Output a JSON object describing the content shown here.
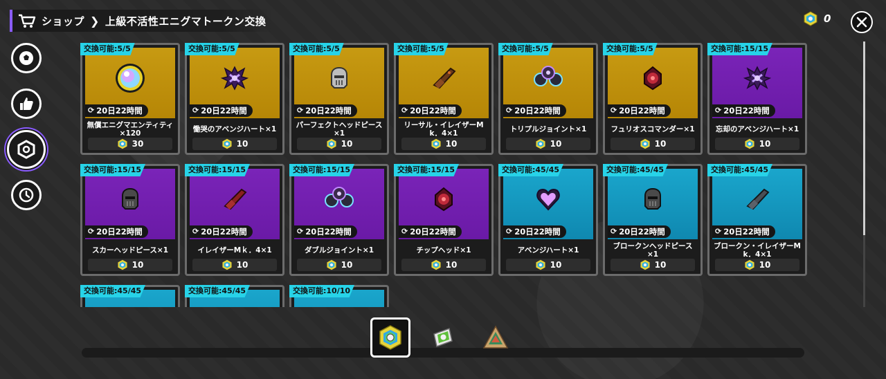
{
  "header": {
    "section": "ショップ",
    "separator": "❯",
    "title": "上級不活性エニグマトークン交換"
  },
  "currency": {
    "value": "0"
  },
  "sidebar": [
    {
      "name": "sidebar-ball",
      "icon": "ball-icon"
    },
    {
      "name": "sidebar-like",
      "icon": "thumbs-up-icon"
    },
    {
      "name": "sidebar-token",
      "icon": "token-icon",
      "active": true
    },
    {
      "name": "sidebar-clock",
      "icon": "clock-icon"
    }
  ],
  "cards": [
    {
      "limit": "交換可能:5/5",
      "timer": "20日22時間",
      "name": "無償エニグマエンティティ\n×120",
      "price": "30",
      "color": "gold",
      "art": "orb"
    },
    {
      "limit": "交換可能:5/5",
      "timer": "20日22時間",
      "name": "慟哭のアベンジハート×1",
      "price": "10",
      "color": "gold",
      "art": "heart-dark"
    },
    {
      "limit": "交換可能:5/5",
      "timer": "20日22時間",
      "name": "パーフェクトヘッドピース\n×1",
      "price": "10",
      "color": "gold",
      "art": "helmet-silver"
    },
    {
      "limit": "交換可能:5/5",
      "timer": "20日22時間",
      "name": "リーサル・イレイザーM\nk．4×1",
      "price": "10",
      "color": "gold",
      "art": "arm-brown"
    },
    {
      "limit": "交換可能:5/5",
      "timer": "20日22時間",
      "name": "トリプルジョイント×1",
      "price": "10",
      "color": "gold",
      "art": "joint-cyan"
    },
    {
      "limit": "交換可能:5/5",
      "timer": "20日22時間",
      "name": "フュリオスコマンダー×1",
      "price": "10",
      "color": "gold",
      "art": "chip-red"
    },
    {
      "limit": "交換可能:15/15",
      "timer": "20日22時間",
      "name": "忘却のアベンジハート×1",
      "price": "10",
      "color": "purple",
      "art": "heart-dark"
    },
    {
      "limit": "交換可能:15/15",
      "timer": "20日22時間",
      "name": "スカーヘッドピース×1",
      "price": "10",
      "color": "purple",
      "art": "helmet-dark"
    },
    {
      "limit": "交換可能:15/15",
      "timer": "20日22時間",
      "name": "イレイザーMｋ．4×1",
      "price": "10",
      "color": "purple",
      "art": "arm-red"
    },
    {
      "limit": "交換可能:15/15",
      "timer": "20日22時間",
      "name": "ダブルジョイント×1",
      "price": "10",
      "color": "purple",
      "art": "joint-cyan"
    },
    {
      "limit": "交換可能:15/15",
      "timer": "20日22時間",
      "name": "チップヘッド×1",
      "price": "10",
      "color": "purple",
      "art": "chip-red"
    },
    {
      "limit": "交換可能:45/45",
      "timer": "20日22時間",
      "name": "アベンジハート×1",
      "price": "10",
      "color": "cyan",
      "art": "heart-pink"
    },
    {
      "limit": "交換可能:45/45",
      "timer": "20日22時間",
      "name": "ブロークンヘッドピース\n×1",
      "price": "10",
      "color": "cyan",
      "art": "helmet-dark"
    },
    {
      "limit": "交換可能:45/45",
      "timer": "20日22時間",
      "name": "ブロークン・イレイザーM\nk．4×1",
      "price": "10",
      "color": "cyan",
      "art": "arm-grey"
    },
    {
      "limit": "交換可能:45/45",
      "timer": "",
      "name": "",
      "price": "",
      "color": "cyan",
      "art": ""
    },
    {
      "limit": "交換可能:45/45",
      "timer": "",
      "name": "",
      "price": "",
      "color": "cyan",
      "art": ""
    },
    {
      "limit": "交換可能:10/10",
      "timer": "",
      "name": "",
      "price": "",
      "color": "cyan",
      "art": ""
    }
  ],
  "tabs": [
    {
      "icon": "enigma-token-icon",
      "active": true
    },
    {
      "icon": "green-token-icon",
      "active": false
    },
    {
      "icon": "triangle-token-icon",
      "active": false
    }
  ]
}
